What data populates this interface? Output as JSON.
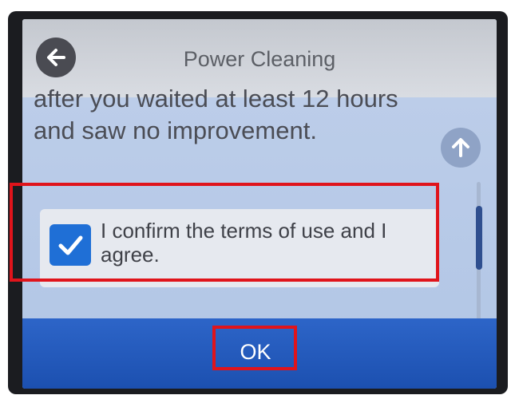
{
  "header": {
    "title": "Power Cleaning",
    "back_icon": "arrow-left-icon"
  },
  "content": {
    "line_1": "after you waited at least 12 hours",
    "line_2": "and saw no improvement.",
    "scroll_up_icon": "arrow-up-icon"
  },
  "confirm": {
    "checked": true,
    "label": "I confirm the terms of use and I agree."
  },
  "footer": {
    "ok_label": "OK"
  },
  "colors": {
    "accent": "#1f6fd6",
    "footer": "#2457bd",
    "highlight": "#e0141b"
  }
}
